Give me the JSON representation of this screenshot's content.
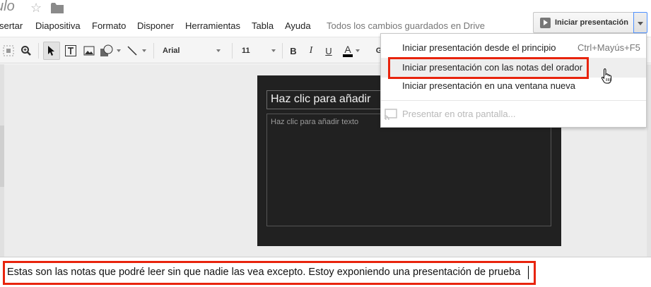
{
  "title": {
    "doc_title": "ulo",
    "star_icon": "star-outline",
    "folder_icon": "folder"
  },
  "present": {
    "button_label": "Iniciar presentación",
    "play_icon": "play-icon",
    "arrow_icon": "chevron-down-icon"
  },
  "menubar": {
    "items": [
      "sertar",
      "Diapositiva",
      "Formato",
      "Disponer",
      "Herramientas",
      "Tabla",
      "Ayuda"
    ],
    "saved_status": "Todos los cambios guardados en Drive"
  },
  "toolbar": {
    "font_name": "Arial",
    "font_size": "11",
    "bold": "B",
    "italic": "I",
    "underline": "U",
    "text_color": "A",
    "more": "G"
  },
  "slide": {
    "title_placeholder": "Haz clic para añadir",
    "body_placeholder": "Haz clic para añadir texto"
  },
  "present_menu": {
    "items": [
      {
        "label": "Iniciar presentación desde el principio",
        "shortcut": "Ctrl+Mayús+F5"
      },
      {
        "label": "Iniciar presentación con las notas del orador",
        "shortcut": ""
      },
      {
        "label": "Iniciar presentación en una ventana nueva",
        "shortcut": ""
      },
      {
        "label": "Presentar en otra pantalla...",
        "shortcut": ""
      }
    ]
  },
  "notes": {
    "text": "Estas son las notas que podré leer sin que nadie las vea excepto. Estoy exponiendo una presentación de prueba"
  },
  "colors": {
    "highlight": "#e8240d",
    "slide_bg": "#212121",
    "focus_blue": "#4d90fe"
  }
}
